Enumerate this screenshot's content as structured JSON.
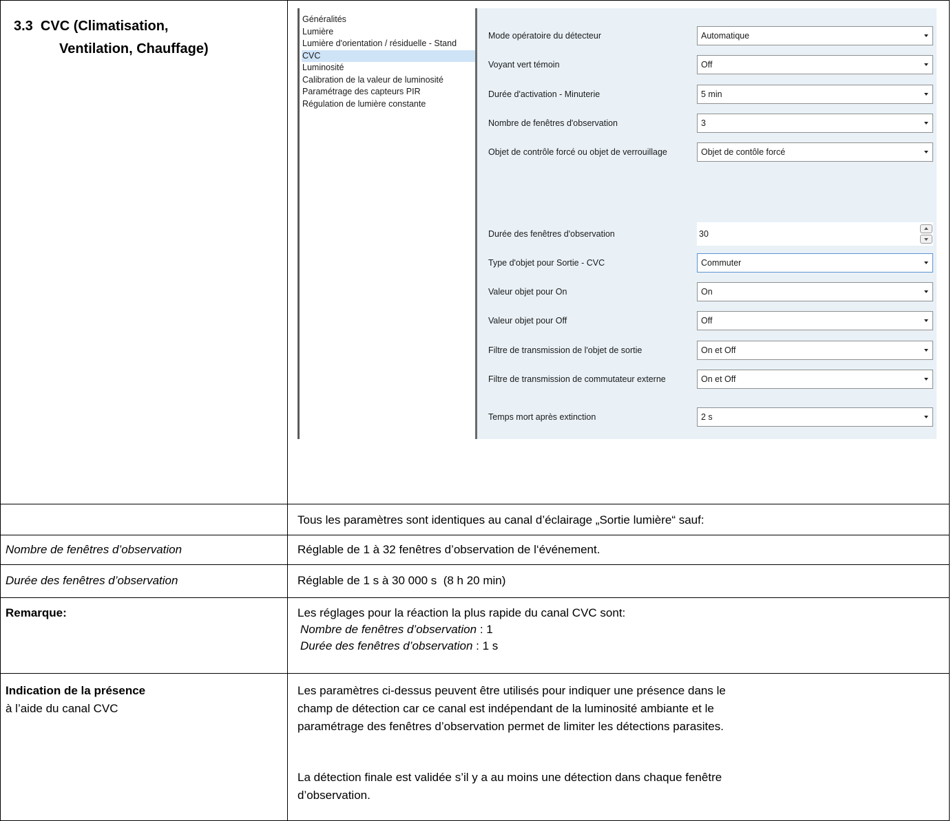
{
  "section": {
    "title_line1": "3.3  CVC (Climatisation,",
    "title_line2": "Ventilation, Chauffage)"
  },
  "screenshot": {
    "nav_items": [
      "Généralités",
      "Lumière",
      "Lumière d'orientation / résiduelle - Stand",
      "CVC",
      "Luminosité",
      "Calibration de la valeur de luminosité",
      "Paramétrage des capteurs PIR",
      "Régulation de lumière constante"
    ],
    "selected_nav": "CVC",
    "params": [
      {
        "label": "Mode opératoire du détecteur",
        "value": "Automatique"
      },
      {
        "label": "Voyant vert témoin",
        "value": "Off"
      },
      {
        "label": "Durée d'activation - Minuterie",
        "value": "5 min"
      },
      {
        "label": "Nombre de fenêtres d'observation",
        "value": "3"
      },
      {
        "label": "Objet de contrôle forcé ou objet de verrouillage",
        "value": "Objet de contôle forcé"
      },
      {
        "label": "Durée des fenêtres d'observation",
        "value": "30"
      },
      {
        "label": "Type d'objet pour Sortie - CVC",
        "value": "Commuter"
      },
      {
        "label": "Valeur objet pour On",
        "value": "On"
      },
      {
        "label": "Valeur objet pour Off",
        "value": "Off"
      },
      {
        "label": "Filtre de transmission de l'objet de sortie",
        "value": "On et Off"
      },
      {
        "label": "Filtre de transmission de commutateur externe",
        "value": "On et Off"
      },
      {
        "label": "Temps mort après extinction",
        "value": "2 s"
      }
    ]
  },
  "rows": {
    "intro": "Tous les paramètres sont identiques au canal d’éclairage „Sortie lumière“ sauf:",
    "nombre_label": "Nombre de fenêtres d’observation",
    "nombre_desc": "Réglable de 1 à 32 fenêtres d’observation de l‘événement.",
    "duree_label": "Durée des fenêtres d’observation",
    "duree_desc": "Réglable de 1 s à 30 000 s  (8 h 20 min)",
    "remarque_label": "Remarque:",
    "remarque_line1": "Les réglages pour la réaction la plus rapide du canal CVC sont:",
    "remarque_line2_italic": "Nombre de fenêtres d’observation",
    "remarque_line2_rest": " : 1",
    "remarque_line3_italic": "Durée des fenêtres d’observation",
    "remarque_line3_rest": " : 1 s",
    "presence_label_bold": "Indication de la présence",
    "presence_label_sub": "à l’aide du canal CVC",
    "presence_p1_l1": "Les paramètres ci-dessus peuvent être utilisés pour indiquer une présence dans le",
    "presence_p1_l2": "champ de détection car ce canal est indépendant de la luminosité ambiante et le",
    "presence_p1_l3": "paramétrage des fenêtres d’observation permet de limiter les détections parasites.",
    "presence_p2_l1": "La détection finale est validée s’il y a au moins une détection dans chaque fenêtre",
    "presence_p2_l2": "d’observation."
  }
}
